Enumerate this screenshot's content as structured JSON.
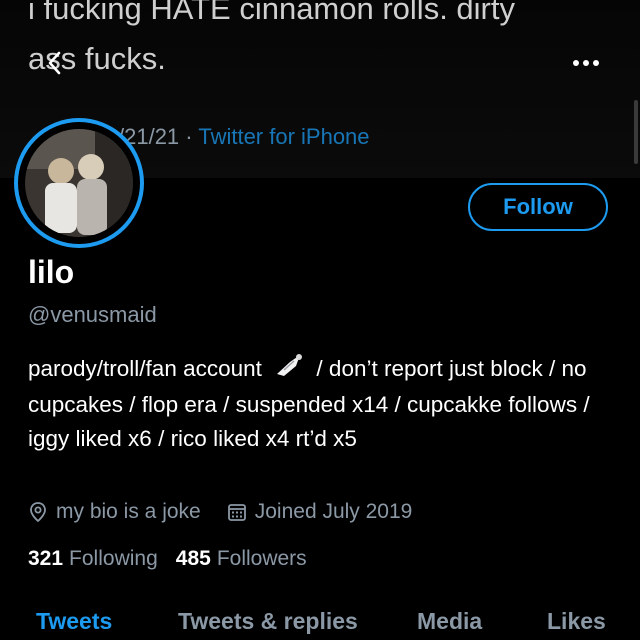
{
  "header": {
    "pinned_tweet_text": "i fucking HATE cinnamon rolls. dirty\nass fucks.",
    "tweet_date": "/21/21",
    "separator": "·",
    "tweet_source": "Twitter for iPhone"
  },
  "toolbar": {
    "back_icon": "chevron-left-icon",
    "more_icon": "more-dots-icon"
  },
  "profile": {
    "name": "lilo",
    "handle": "@venusmaid",
    "follow_label": "Follow",
    "bio_part1": "parody/troll/fan account",
    "bio_emoji": "bouquet-icon",
    "bio_part2": "/ don’t report just block / no cupcakes / flop era / suspended x14 / cupcakke follows / iggy liked x6 / rico liked x4 rt’d x5",
    "location": "my bio is a joke",
    "joined": "Joined July 2019",
    "following_count": "321",
    "following_label": "Following",
    "followers_count": "485",
    "followers_label": "Followers"
  },
  "tabs": [
    {
      "label": "Tweets",
      "active": true
    },
    {
      "label": "Tweets & replies",
      "active": false
    },
    {
      "label": "Media",
      "active": false
    },
    {
      "label": "Likes",
      "active": false
    }
  ],
  "colors": {
    "accent": "#1d9bf0",
    "background": "#000000",
    "secondary_text": "#8b98a5"
  }
}
